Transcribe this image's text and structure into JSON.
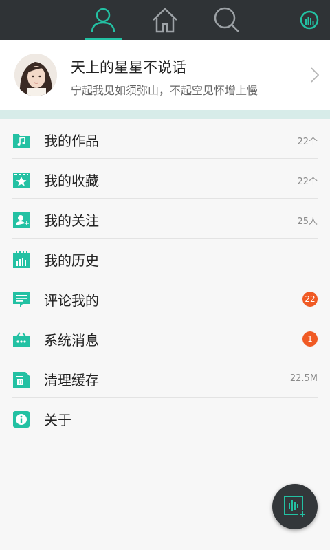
{
  "colors": {
    "accent": "#23c1a3",
    "topbar": "#2f3336",
    "badge": "#f05a24",
    "band": "#d7ece9"
  },
  "nav": {
    "tabs": [
      {
        "icon": "person-icon",
        "active": true
      },
      {
        "icon": "home-icon",
        "active": false
      },
      {
        "icon": "search-icon",
        "active": false
      },
      {
        "icon": "equalizer-icon",
        "active": false
      }
    ]
  },
  "profile": {
    "name": "天上的星星不说话",
    "signature": "宁起我见如须弥山，不起空见怀增上慢"
  },
  "menu": {
    "items": [
      {
        "label": "我的作品",
        "icon": "music-folder-icon",
        "count": "22个"
      },
      {
        "label": "我的收藏",
        "icon": "star-icon",
        "count": "22个"
      },
      {
        "label": "我的关注",
        "icon": "follow-icon",
        "count": "25人"
      },
      {
        "label": "我的历史",
        "icon": "history-icon",
        "count": ""
      },
      {
        "label": "评论我的",
        "icon": "comment-icon",
        "badge": "22"
      },
      {
        "label": "系统消息",
        "icon": "message-icon",
        "badge": "1"
      },
      {
        "label": "清理缓存",
        "icon": "clean-icon",
        "count": "22.5M"
      },
      {
        "label": "关于",
        "icon": "info-icon",
        "count": ""
      }
    ]
  },
  "fab": {
    "icon": "add-audio-icon"
  }
}
